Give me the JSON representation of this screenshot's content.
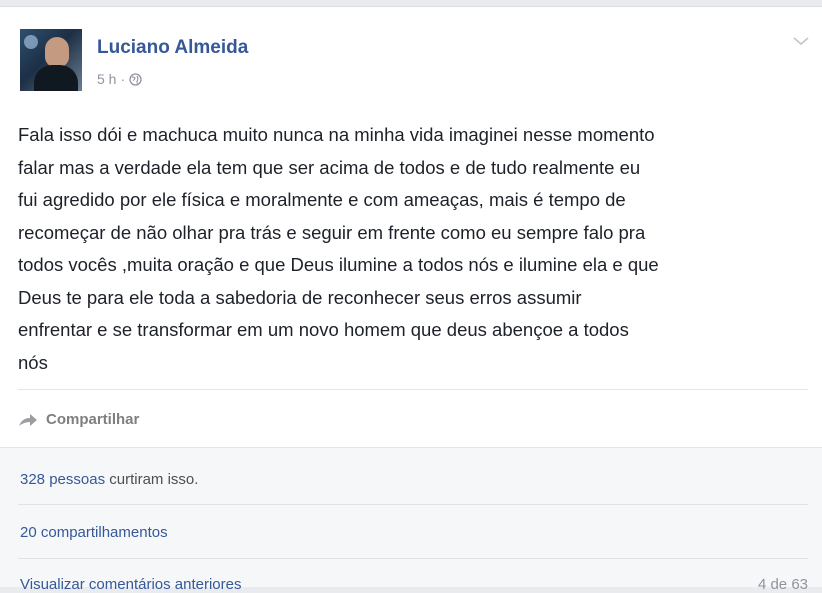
{
  "post": {
    "author": "Luciano Almeida",
    "time": "5 h",
    "time_separator": "·",
    "lines": [
      "Fala isso dói e machuca muito nunca na minha vida imaginei nesse momento",
      "falar mas a verdade ela tem que ser acima de todos e de tudo realmente eu",
      "fui agredido por ele física e moralmente e com ameaças, mais é tempo de",
      "recomeçar de não olhar pra trás e seguir em frente como eu sempre falo pra",
      "todos vocês ,muita oração e que Deus ilumine a todos nós e ilumine ela e que",
      "Deus te para ele toda a sabedoria de reconhecer seus erros assumir",
      "enfrentar e se transformar em um novo homem que deus abençoe a todos",
      "nós"
    ],
    "icons": {
      "audience": "globe-icon",
      "options": "chevron-down-icon",
      "share": "share-arrow-icon"
    }
  },
  "actions": {
    "share_label": "Compartilhar"
  },
  "summary": {
    "likes_count": "328",
    "likes_link": "pessoas",
    "likes_suffix": "curtiram isso.",
    "shares": "20 compartilhamentos",
    "view_previous": "Visualizar comentários anteriores",
    "pager": "4 de 63"
  },
  "colors": {
    "link": "#365899",
    "text": "#1d2129",
    "muted": "#90949c",
    "summary_bg": "#f6f7f9"
  }
}
